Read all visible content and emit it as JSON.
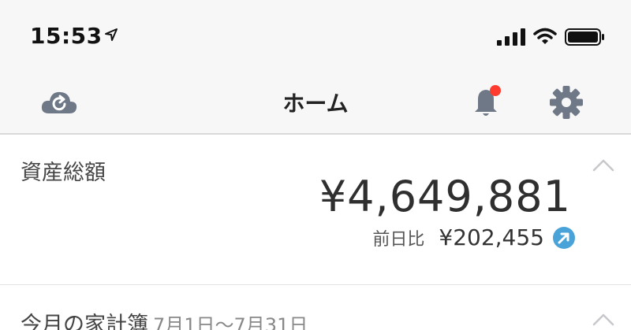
{
  "status_bar": {
    "time": "15:53",
    "icons": [
      "location-arrow-icon",
      "cellular-signal-icon",
      "wifi-icon",
      "battery-icon"
    ]
  },
  "navbar": {
    "title": "ホーム",
    "icons": [
      "cloud-sync-icon",
      "bell-icon",
      "gear-icon"
    ],
    "notification_dot_color": "#ff3b30",
    "icon_color": "#6f7886"
  },
  "assets_card": {
    "title": "資産総額",
    "total": "¥4,649,881",
    "diff_label": "前日比",
    "diff_value": "¥202,455",
    "trend_icon": "arrow-up-right-icon",
    "trend_color": "#4aa3d8"
  },
  "budget_card": {
    "title": "今月の家計簿",
    "range": "7月1日〜7月31日"
  }
}
